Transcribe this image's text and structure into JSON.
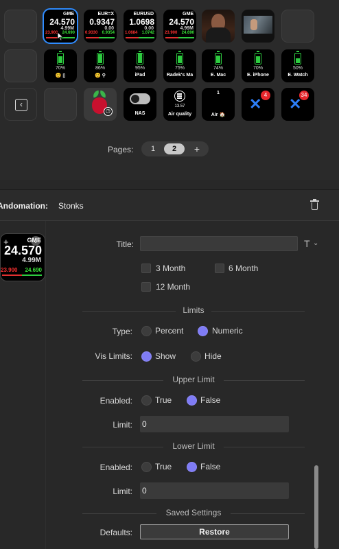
{
  "keys": {
    "stock_gme": {
      "ticker": "GME",
      "price": "24.570",
      "volume": "4.99M",
      "low": "23.900",
      "high": "24.690"
    },
    "stock_eurx": {
      "ticker": "EUR=X",
      "price": "0.9347",
      "volume": "0.00",
      "low": "0.9330",
      "high": "0.9354"
    },
    "stock_eurusd": {
      "ticker": "EURUSD",
      "price": "1.0698",
      "volume": "0.00",
      "low": "1.0684",
      "high": "1.0742"
    },
    "stock_gme2": {
      "ticker": "GME",
      "price": "24.570",
      "volume": "4.99M",
      "low": "23.900",
      "high": "24.690"
    },
    "devices": [
      {
        "pct": "70%",
        "name": "😊 ▯",
        "level": 0.7
      },
      {
        "pct": "86%",
        "name": "😊 ⚲",
        "level": 0.86
      },
      {
        "pct": "95%",
        "name": "iPad",
        "level": 0.95
      },
      {
        "pct": "75%",
        "name": "Radek's Ma",
        "level": 0.75
      },
      {
        "pct": "74%",
        "name": "E. Mac",
        "level": 0.74
      },
      {
        "pct": "70%",
        "name": "E. iPhone",
        "level": 0.7
      },
      {
        "pct": "50%",
        "name": "E. Watch",
        "level": 0.5
      }
    ],
    "back_glyph": "‹",
    "pihole_clock": "◷",
    "nas_label": "NAS",
    "air_quality_value": "13.57",
    "air_quality_label": "Air quality",
    "air_home_value": "1",
    "air_home_label": "Air 🏠",
    "jira_glyph": "✕",
    "jira_badge_1": "4",
    "jira_badge_2": "34"
  },
  "pages": {
    "label": "Pages:",
    "items": [
      "1",
      "2"
    ],
    "current": "2",
    "add": "+"
  },
  "inspector": {
    "label": "Andomation:",
    "value": "Stonks",
    "preview": {
      "plus": "+",
      "chevron": "⌄",
      "ticker": "GME",
      "price": "24.570",
      "volume": "4.99M",
      "low": "23.900",
      "high": "24.690"
    },
    "title_label": "Title:",
    "title_value": "",
    "title_font_icon": "T",
    "title_font_chevron": "⌄",
    "periods": {
      "three_month": "3 Month",
      "six_month": "6 Month",
      "twelve_month": "12 Month"
    },
    "limits_header": "Limits",
    "type_label": "Type:",
    "type_options": {
      "percent": "Percent",
      "numeric": "Numeric"
    },
    "type_selected": "Numeric",
    "vis_label": "Vis Limits:",
    "vis_options": {
      "show": "Show",
      "hide": "Hide"
    },
    "vis_selected": "Show",
    "upper_header": "Upper Limit",
    "upper_enabled_label": "Enabled:",
    "upper_options": {
      "true": "True",
      "false": "False"
    },
    "upper_selected": "False",
    "upper_limit_label": "Limit:",
    "upper_limit_value": "0",
    "lower_header": "Lower Limit",
    "lower_enabled_label": "Enabled:",
    "lower_options": {
      "true": "True",
      "false": "False"
    },
    "lower_selected": "False",
    "lower_limit_label": "Limit:",
    "lower_limit_value": "0",
    "saved_header": "Saved Settings",
    "defaults_label": "Defaults:",
    "restore_label": "Restore"
  },
  "colors": {
    "accent": "#7f7cf5",
    "selection": "#2f8cff",
    "up": "#39e639",
    "down": "#ff3030",
    "battery": "#2ecc40"
  }
}
